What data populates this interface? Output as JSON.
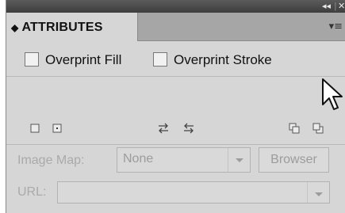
{
  "panel": {
    "title": "ATTRIBUTES",
    "collapse_glyph": "◂◂",
    "close_glyph": "✕",
    "collapse_icon": "double-left-chevron-icon",
    "close_icon": "close-icon",
    "menu_icon": "panel-menu-icon"
  },
  "overprint": {
    "fill_label": "Overprint Fill",
    "fill_checked": false,
    "stroke_label": "Overprint Stroke",
    "stroke_checked": false
  },
  "toolbar_icons": [
    "attribute-square-icon",
    "attribute-square-dot-icon",
    "swap-arrows-icon",
    "swap-arrows-alt-icon",
    "stack-up-icon",
    "stack-down-icon"
  ],
  "image_map": {
    "label": "Image Map:",
    "selected": "None",
    "browser_label": "Browser"
  },
  "url": {
    "label": "URL:",
    "value": ""
  }
}
